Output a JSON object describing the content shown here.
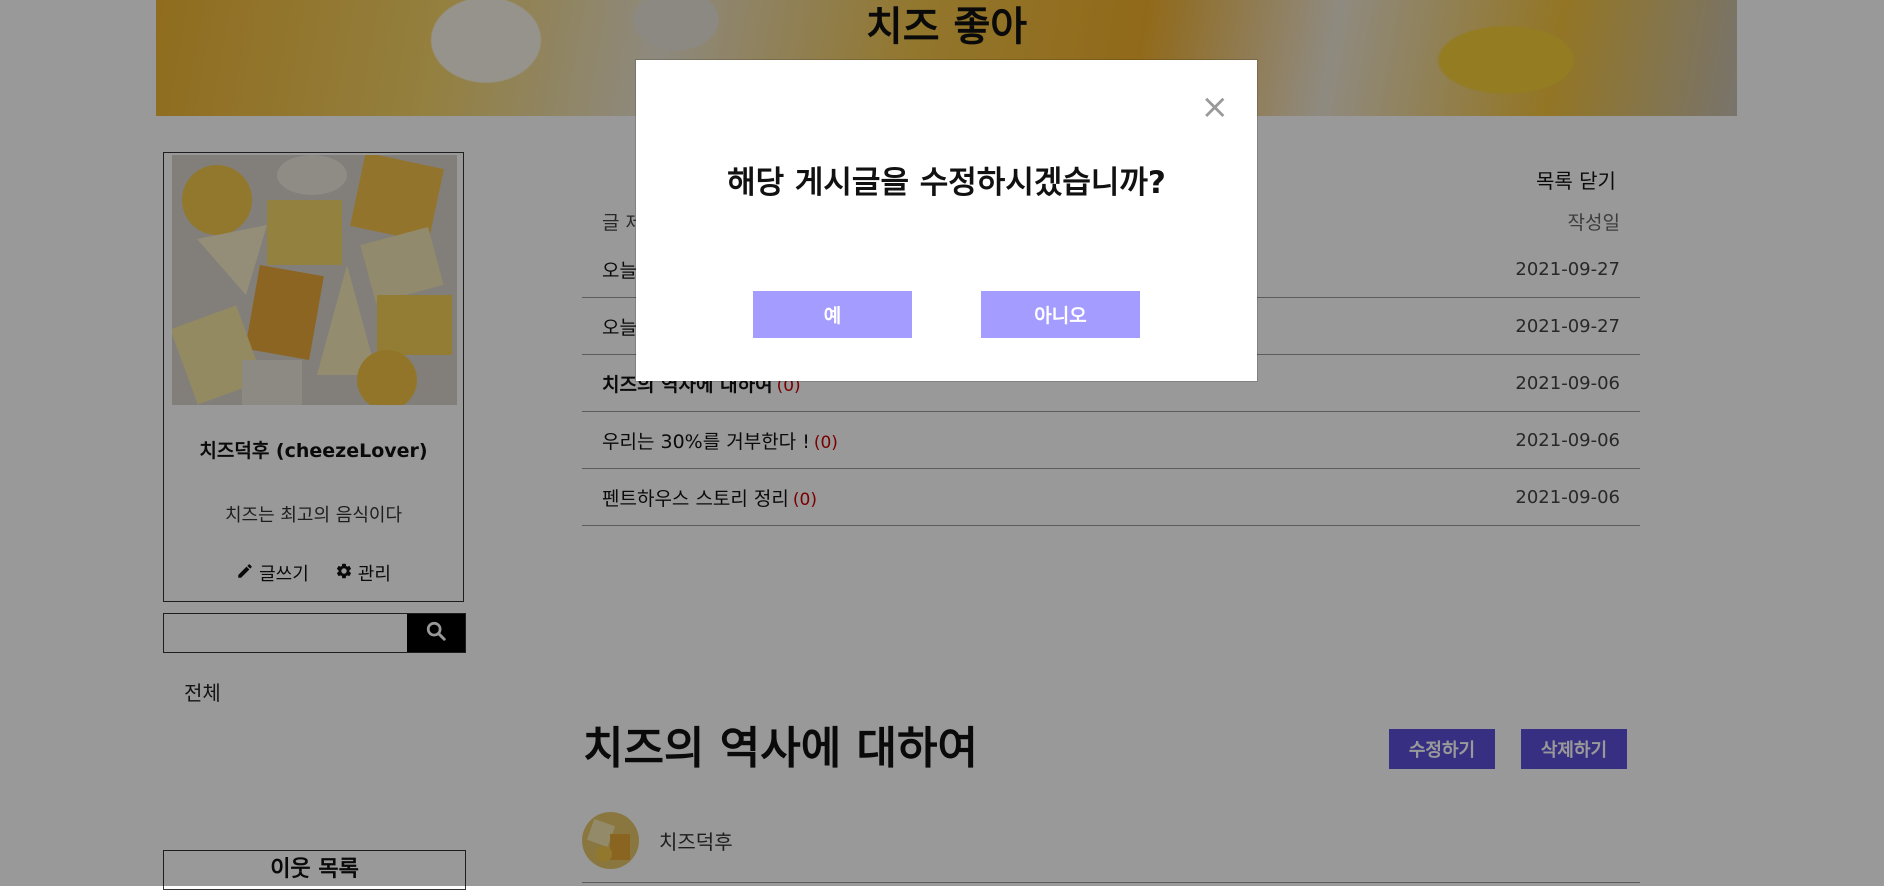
{
  "blog": {
    "title": "치즈 좋아"
  },
  "profile": {
    "name": "치즈덕후 (cheezeLover)",
    "bio": "치즈는 최고의 음식이다",
    "write_label": "글쓰기",
    "manage_label": "관리"
  },
  "search": {
    "value": "",
    "placeholder": ""
  },
  "sidebar": {
    "category_all": "전체",
    "neighbors_title": "이웃 목록"
  },
  "post_list": {
    "close_label": "목록 닫기",
    "col_title": "글 제목",
    "col_date": "작성일",
    "rows": [
      {
        "title": "오늘",
        "count": "",
        "date": "2021-09-27"
      },
      {
        "title": "오늘",
        "count": "",
        "date": "2021-09-27"
      },
      {
        "title": "치즈의 역사에 대하여",
        "count": "(0)",
        "date": "2021-09-06"
      },
      {
        "title": "우리는 30%를 거부한다 !",
        "count": "(0)",
        "date": "2021-09-06"
      },
      {
        "title": "펜트하우스 스토리 정리",
        "count": "(0)",
        "date": "2021-09-06"
      }
    ]
  },
  "article": {
    "title": "치즈의 역사에 대하여",
    "edit_label": "수정하기",
    "delete_label": "삭제하기",
    "author": "치즈덕후"
  },
  "modal": {
    "close_symbol": "×",
    "question": "해당 게시글을 수정하시겠습니까?",
    "yes_label": "예",
    "no_label": "아니오"
  },
  "colors": {
    "overlay": "rgba(0,0,0,0.4)",
    "modal_button": "#a59cff",
    "action_button": "#5d50d9",
    "comment_count": "#cc0000"
  }
}
